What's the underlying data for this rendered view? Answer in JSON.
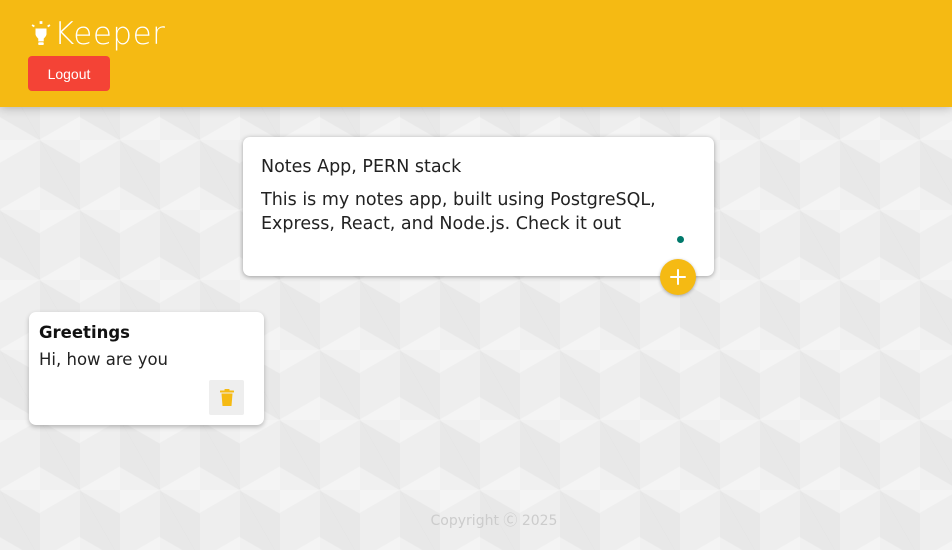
{
  "header": {
    "app_title": "Keeper",
    "logout_label": "Logout",
    "colors": {
      "header_bg": "#f5ba13",
      "logout_bg": "#f44336"
    },
    "icons": {
      "logo": "lightbulb-icon"
    }
  },
  "create_note": {
    "title_value": "Notes App, PERN stack",
    "content_value": "This is my notes app, built using PostgreSQL, Express, React, and Node.js. Check it out",
    "add_icon": "plus-icon"
  },
  "notes": [
    {
      "title": "Greetings",
      "content": "Hi, how are you",
      "delete_icon": "trash-icon"
    }
  ],
  "footer": {
    "copyright": "Copyright Ⓒ 2025"
  }
}
